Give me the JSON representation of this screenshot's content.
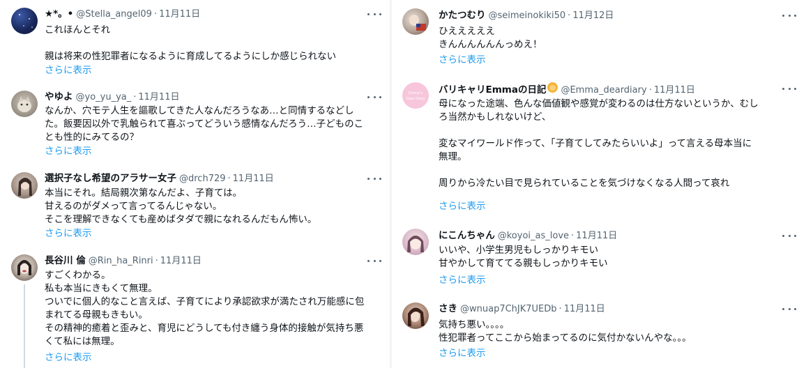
{
  "left": [
    {
      "name": "★*。•",
      "handle": "@Stella_angel09",
      "date": "11月11日",
      "body": "これほんとそれ\n\n親は将来の性犯罪者になるように育成してるようにしか感じられない",
      "show_more": "さらに表示"
    },
    {
      "name": "やゆよ",
      "handle": "@yo_yu_ya_",
      "date": "11月11日",
      "body": "なんか、穴モテ人生を謳歌してきた人なんだろうなあ…と同情するなどし\nた。飯要因以外で乳触られて喜ぶってどういう感情なんだろう…子どものこ\nとも性的にみてるの？",
      "show_more": "さらに表示"
    },
    {
      "name": "選択子なし希望のアラサー女子",
      "handle": "@drch729",
      "date": "11月11日",
      "body": "本当にそれ。結局親次第なんだよ、子育ては。\n甘えるのがダメって言ってるんじゃない。\nそこを理解できなくても産めばタダで親になれるんだもん怖い。",
      "show_more": "さらに表示"
    },
    {
      "name": "長谷川 倫",
      "handle": "@Rin_ha_Rinri",
      "date": "11月11日",
      "body": "すごくわかる。\n私も本当にきもくて無理。\nついでに個人的なこと言えば、子育てにより承認欲求が満たされ万能感に包\nまれてる母親もきもい。\nその精神的癒着と歪みと、育児にどうしても付き纏う身体的接触が気持ち悪\nくて私には無理。",
      "show_more": "さらに表示"
    }
  ],
  "right": [
    {
      "name": "かたつむり",
      "handle": "@seimeinokiki50",
      "date": "11月12日",
      "body": "ひえええええ\nきんんんんんんっめえ！",
      "show_more": "さらに表示"
    },
    {
      "name": "バリキャリEmmaの日記",
      "handle": "@Emma_deardiary",
      "date": "11月11日",
      "body": "母になった途端、色んな価値観や感覚が変わるのは仕方ないというか、むし\nろ当然かもしれないけど、\n\n変なマイワールド作って、「子育てしてみたらいいよ」って言える母本当に\n無理。\n\n周りから冷たい目で見られていることを気づけなくなる人間って哀れ",
      "show_more": "さらに表示",
      "avatar_text": "Emma's Dear Diary"
    },
    {
      "name": "にこんちゃん",
      "handle": "@koyoi_as_love",
      "date": "11月11日",
      "body": "いいや、小学生男児もしっかりキモい\n甘やかして育ててる親もしっかりキモい",
      "show_more": "さらに表示"
    },
    {
      "name": "さき",
      "handle": "@wnuap7ChJK7UEDb",
      "date": "11月11日",
      "body": "気持ち悪い。。。。\n性犯罪者ってここから始まってるのに気付かないんやな。。。",
      "show_more": "さらに表示"
    }
  ],
  "colors": {
    "text": "#0f1419",
    "secondary": "#536471",
    "link": "#1d9bf0",
    "thread_line": "#cfd9de"
  }
}
